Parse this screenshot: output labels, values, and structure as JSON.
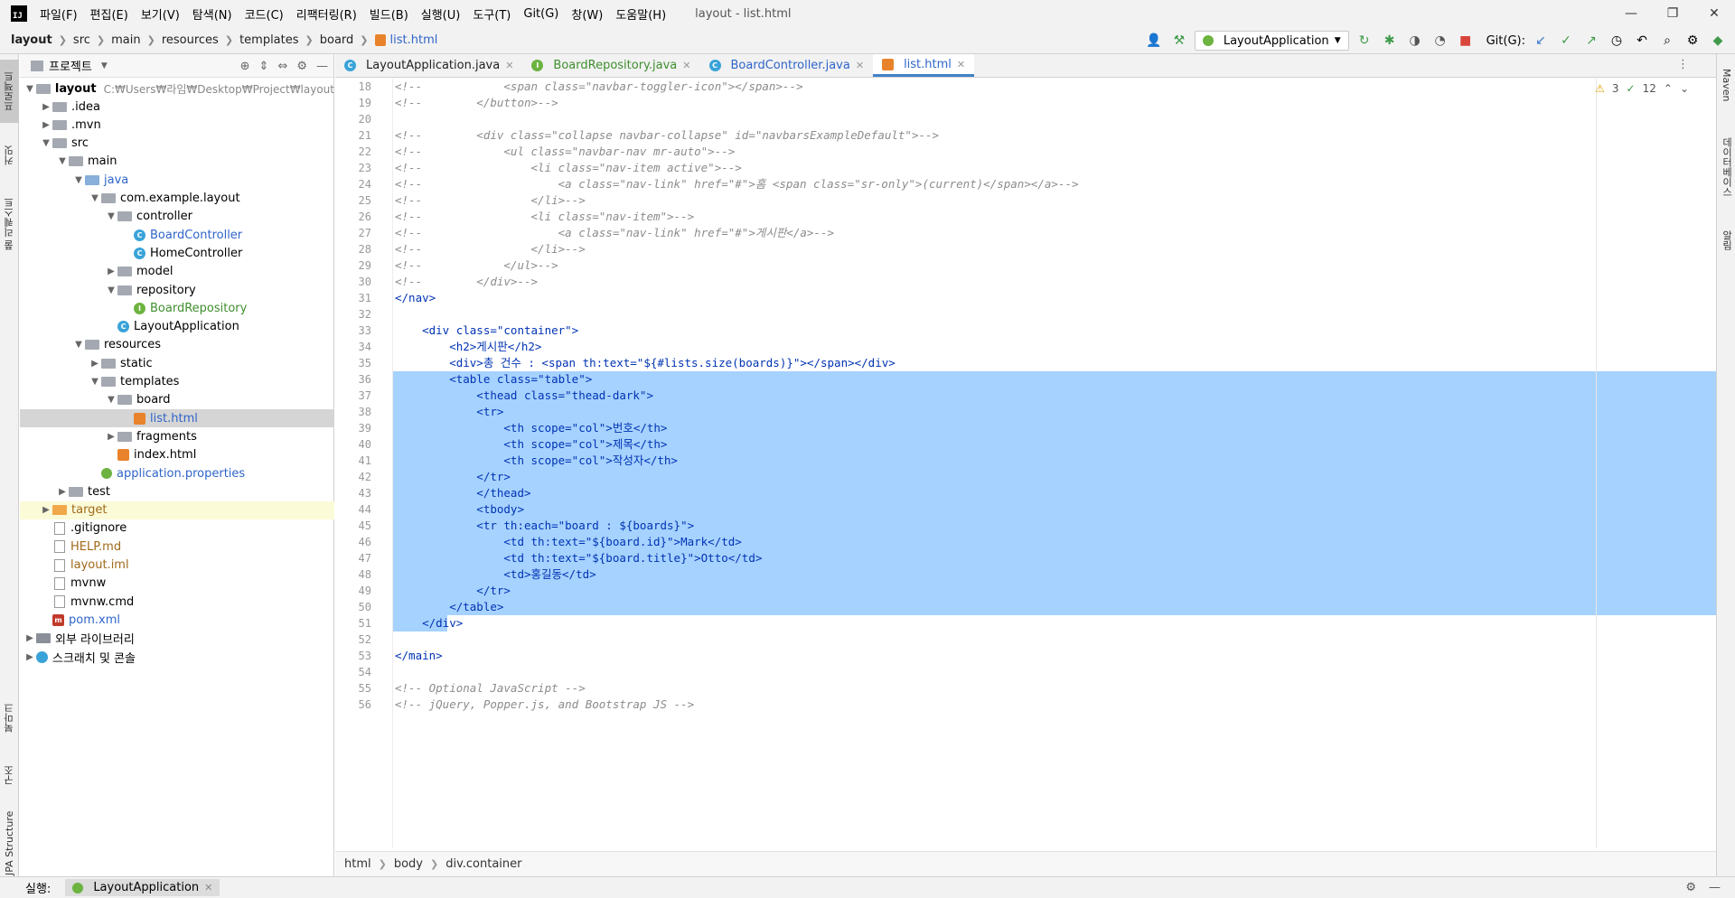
{
  "menubar": {
    "logo": "IJ",
    "items": [
      "파일(F)",
      "편집(E)",
      "보기(V)",
      "탐색(N)",
      "코드(C)",
      "리팩터링(R)",
      "빌드(B)",
      "실행(U)",
      "도구(T)",
      "Git(G)",
      "창(W)",
      "도움말(H)"
    ],
    "window_title": "layout - list.html",
    "minimize": "—",
    "maximize": "❐",
    "close": "✕"
  },
  "navbar": {
    "crumbs": [
      "layout",
      "src",
      "main",
      "resources",
      "templates",
      "board"
    ],
    "file": "list.html",
    "run_config": "LayoutApplication",
    "git_label": "Git(G):"
  },
  "left_strip": {
    "project_tab": "프로젝트",
    "commit_tab": "커밋",
    "pull_requests_tab": "풀 리퀘스트",
    "bookmarks_tab": "북마크",
    "structure_tab": "구조",
    "jpa_tab": "JPA Structure"
  },
  "right_strip": {
    "maven_tab": "Maven",
    "database_tab": "데이터베이스",
    "notifications_tab": "알림"
  },
  "project_panel": {
    "title": "프로젝트",
    "root_name": "layout",
    "root_path": "C:₩Users₩라임₩Desktop₩Project₩layout",
    "tree": [
      {
        "label": ".idea",
        "kind": "folder",
        "color": "default"
      },
      {
        "label": ".mvn",
        "kind": "folder",
        "color": "default"
      },
      {
        "label": "src",
        "kind": "folder",
        "color": "default"
      },
      {
        "label": "main",
        "kind": "folder",
        "color": "default"
      },
      {
        "label": "java",
        "kind": "folder",
        "color": "blue"
      },
      {
        "label": "com.example.layout",
        "kind": "folder",
        "color": "default"
      },
      {
        "label": "controller",
        "kind": "folder",
        "color": "default"
      },
      {
        "label": "BoardController",
        "kind": "class",
        "color": "blue"
      },
      {
        "label": "HomeController",
        "kind": "class",
        "color": "default"
      },
      {
        "label": "model",
        "kind": "folder",
        "color": "default"
      },
      {
        "label": "repository",
        "kind": "folder",
        "color": "default"
      },
      {
        "label": "BoardRepository",
        "kind": "interface",
        "color": "green"
      },
      {
        "label": "LayoutApplication",
        "kind": "class",
        "color": "default"
      },
      {
        "label": "resources",
        "kind": "folder",
        "color": "default"
      },
      {
        "label": "static",
        "kind": "folder",
        "color": "default"
      },
      {
        "label": "templates",
        "kind": "folder",
        "color": "default"
      },
      {
        "label": "board",
        "kind": "folder",
        "color": "default"
      },
      {
        "label": "list.html",
        "kind": "html",
        "color": "blue"
      },
      {
        "label": "fragments",
        "kind": "folder",
        "color": "default"
      },
      {
        "label": "index.html",
        "kind": "html",
        "color": "default"
      },
      {
        "label": "application.properties",
        "kind": "props",
        "color": "blue"
      },
      {
        "label": "test",
        "kind": "folder",
        "color": "default"
      },
      {
        "label": "target",
        "kind": "folder",
        "color": "orange"
      },
      {
        "label": ".gitignore",
        "kind": "file",
        "color": "default"
      },
      {
        "label": "HELP.md",
        "kind": "file",
        "color": "orange"
      },
      {
        "label": "layout.iml",
        "kind": "file",
        "color": "orange"
      },
      {
        "label": "mvnw",
        "kind": "file",
        "color": "default"
      },
      {
        "label": "mvnw.cmd",
        "kind": "file",
        "color": "default"
      },
      {
        "label": "pom.xml",
        "kind": "maven",
        "color": "blue"
      },
      {
        "label": "외부 라이브러리",
        "kind": "lib",
        "color": "default"
      },
      {
        "label": "스크래치 및 콘솔",
        "kind": "scratch",
        "color": "default"
      }
    ]
  },
  "tabs": [
    {
      "label": "LayoutApplication.java"
    },
    {
      "label": "BoardRepository.java"
    },
    {
      "label": "BoardController.java"
    },
    {
      "label": "list.html"
    }
  ],
  "inspections": {
    "warnings": "3",
    "ok": "12"
  },
  "code_lines": [
    {
      "n": "18",
      "text": "<!--            <span class=\"navbar-toggler-icon\"></span>-->"
    },
    {
      "n": "19",
      "text": "<!--        </button>-->"
    },
    {
      "n": "20",
      "text": ""
    },
    {
      "n": "21",
      "text": "<!--        <div class=\"collapse navbar-collapse\" id=\"navbarsExampleDefault\">-->"
    },
    {
      "n": "22",
      "text": "<!--            <ul class=\"navbar-nav mr-auto\">-->"
    },
    {
      "n": "23",
      "text": "<!--                <li class=\"nav-item active\">-->"
    },
    {
      "n": "24",
      "text": "<!--                    <a class=\"nav-link\" href=\"#\">홈 <span class=\"sr-only\">(current)</span></a>-->"
    },
    {
      "n": "25",
      "text": "<!--                </li>-->"
    },
    {
      "n": "26",
      "text": "<!--                <li class=\"nav-item\">-->"
    },
    {
      "n": "27",
      "text": "<!--                    <a class=\"nav-link\" href=\"#\">게시판</a>-->"
    },
    {
      "n": "28",
      "text": "<!--                </li>-->"
    },
    {
      "n": "29",
      "text": "<!--            </ul>-->"
    },
    {
      "n": "30",
      "text": "<!--        </div>-->"
    },
    {
      "n": "31",
      "text": "</nav>"
    },
    {
      "n": "32",
      "text": ""
    },
    {
      "n": "33",
      "text": "    <div class=\"container\">"
    },
    {
      "n": "34",
      "text": "        <h2>게시판</h2>"
    },
    {
      "n": "35",
      "text": "        <div>총 건수 : <span th:text=\"${#lists.size(boards)}\"></span></div>"
    },
    {
      "n": "36",
      "text": "        <table class=\"table\">"
    },
    {
      "n": "37",
      "text": "            <thead class=\"thead-dark\">"
    },
    {
      "n": "38",
      "text": "            <tr>"
    },
    {
      "n": "39",
      "text": "                <th scope=\"col\">번호</th>"
    },
    {
      "n": "40",
      "text": "                <th scope=\"col\">제목</th>"
    },
    {
      "n": "41",
      "text": "                <th scope=\"col\">작성자</th>"
    },
    {
      "n": "42",
      "text": "            </tr>"
    },
    {
      "n": "43",
      "text": "            </thead>"
    },
    {
      "n": "44",
      "text": "            <tbody>"
    },
    {
      "n": "45",
      "text": "            <tr th:each=\"board : ${boards}\">"
    },
    {
      "n": "46",
      "text": "                <td th:text=\"${board.id}\">Mark</td>"
    },
    {
      "n": "47",
      "text": "                <td th:text=\"${board.title}\">Otto</td>"
    },
    {
      "n": "48",
      "text": "                <td>홍길동</td>"
    },
    {
      "n": "49",
      "text": "            </tr>"
    },
    {
      "n": "50",
      "text": "        </table>"
    },
    {
      "n": "51",
      "text": "    </div>"
    },
    {
      "n": "52",
      "text": ""
    },
    {
      "n": "53",
      "text": "</main>"
    },
    {
      "n": "54",
      "text": ""
    },
    {
      "n": "55",
      "text": "<!-- Optional JavaScript -->"
    },
    {
      "n": "56",
      "text": "<!-- jQuery, Popper.js, and Bootstrap JS -->"
    }
  ],
  "editor_footer": [
    "html",
    "body",
    "div.container"
  ],
  "runbar": {
    "label": "실행:",
    "tab": "LayoutApplication"
  },
  "colors": {
    "selection": "#a6d2ff",
    "accent": "#4083c9"
  }
}
